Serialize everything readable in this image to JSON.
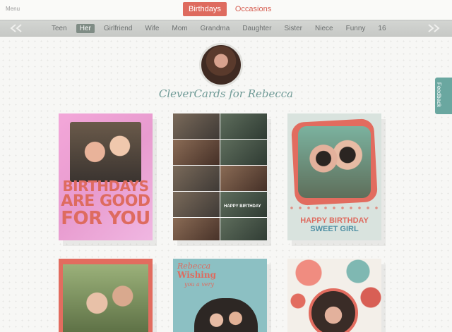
{
  "header": {
    "menu_label": "Menu",
    "tabs": [
      {
        "label": "Birthdays",
        "active": true
      },
      {
        "label": "Occasions",
        "active": false
      }
    ]
  },
  "filters": {
    "items": [
      "Teen",
      "Her",
      "Girlfriend",
      "Wife",
      "Mom",
      "Grandma",
      "Daughter",
      "Sister",
      "Niece",
      "Funny",
      "16"
    ],
    "active": "Her",
    "left_arrow_icon": "double-chevron-left-icon",
    "right_arrow_icon": "double-chevron-right-icon"
  },
  "profile": {
    "title": "CleverCards for Rebecca",
    "avatar_icon": "profile-photo"
  },
  "feedback": {
    "label": "Feedback"
  },
  "cards": [
    {
      "text_lines": [
        "BIRTHDAYS",
        "ARE GOOD",
        "FOR YOU"
      ]
    },
    {
      "text": "HAPPY BIRTHDAY"
    },
    {
      "text_lines": [
        "HAPPY BIRTHDAY",
        "SWEET GIRL"
      ]
    },
    {},
    {
      "text_lines": [
        "Rebecca",
        "Wishing",
        "you a very"
      ]
    },
    {}
  ],
  "colors": {
    "accent": "#de6b5f",
    "teal": "#6aa7a0",
    "filter_bar": "#cfd1ce",
    "title": "#6f9a96"
  }
}
